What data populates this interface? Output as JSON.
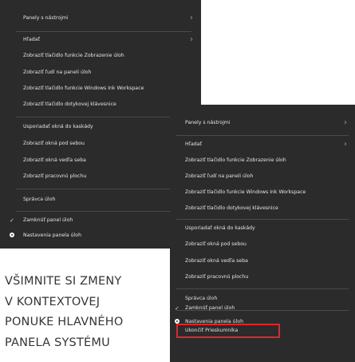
{
  "menu_left": {
    "items": [
      {
        "label": "Panely s nástrojmi",
        "submenu": true
      },
      {
        "label": "Hľadať",
        "submenu": true
      },
      {
        "label": "Zobraziť tlačidlo funkcie Zobrazenie úloh"
      },
      {
        "label": "Zobraziť ľudí na paneli úloh"
      },
      {
        "label": "Zobraziť tlačidlo funkcie Windows Ink Workspace"
      },
      {
        "label": "Zobraziť tlačidlo dotykovej klávesnice"
      },
      {
        "label": "Usporiadať okná do kaskády"
      },
      {
        "label": "Zobraziť okná pod sebou"
      },
      {
        "label": "Zobraziť okná vedľa seba"
      },
      {
        "label": "Zobraziť pracovnú plochu"
      },
      {
        "label": "Správca úloh"
      },
      {
        "label": "Zamknúť panel úloh",
        "checked": true
      },
      {
        "label": "Nastavenia panela úloh",
        "icon": "gear-icon"
      }
    ]
  },
  "menu_right": {
    "items": [
      {
        "label": "Panely s nástrojmi",
        "submenu": true
      },
      {
        "label": "Hľadať",
        "submenu": true
      },
      {
        "label": "Zobraziť tlačidlo funkcie Zobrazenie úloh"
      },
      {
        "label": "Zobraziť ľudí na paneli úloh"
      },
      {
        "label": "Zobraziť tlačidlo funkcie Windows Ink Workspace"
      },
      {
        "label": "Zobraziť tlačidlo dotykovej klávesnice"
      },
      {
        "label": "Usporiadať okná do kaskády"
      },
      {
        "label": "Zobraziť okná pod sebou"
      },
      {
        "label": "Zobraziť okná vedľa seba"
      },
      {
        "label": "Zobraziť pracovnú plochu"
      },
      {
        "label": "Správca úloh"
      },
      {
        "label": "Zamknúť panel úloh",
        "checked": true
      },
      {
        "label": "Nastavenia panela úloh",
        "icon": "gear-icon"
      },
      {
        "label": "Ukončiť Prieskumníka"
      }
    ]
  },
  "caption": {
    "lines": [
      "VŠIMNITE SI ZMENY",
      "V KONTEXTOVEJ",
      "PONUKE HLAVNÉHO",
      "PANELA SYSTÉMU"
    ]
  },
  "colors": {
    "menu_background": "#2b2b2b",
    "menu_text": "#e4e4e4",
    "separator": "#4a4a4a",
    "highlight_border": "#e0262b",
    "caption_text": "#353535"
  }
}
